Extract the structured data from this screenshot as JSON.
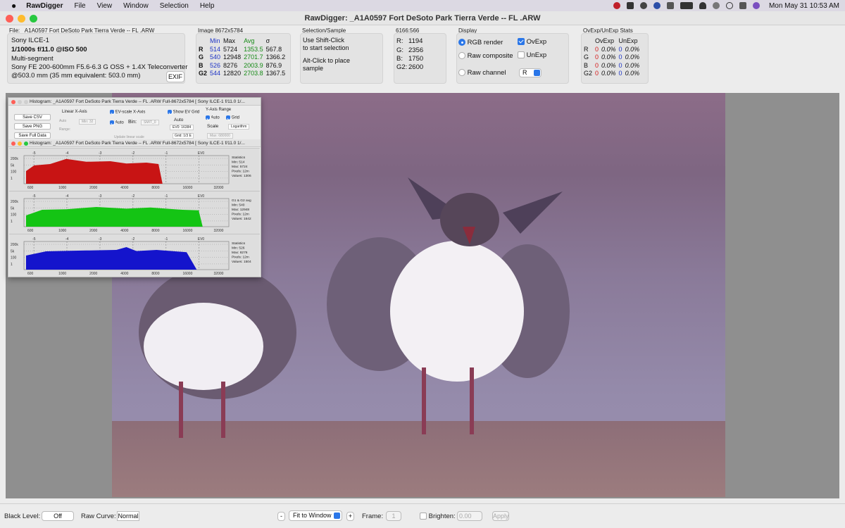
{
  "menubar": {
    "apple": "",
    "app": "RawDigger",
    "items": [
      "File",
      "View",
      "Window",
      "Selection",
      "Help"
    ],
    "clock": "Mon May 31  10:53 AM"
  },
  "window": {
    "title": "RawDigger: _A1A0597 Fort DeSoto Park Tierra Verde -- FL .ARW"
  },
  "file_panel": {
    "label": "File: _A1A0597 Fort DeSoto Park Tierra Verde -- FL .ARW",
    "camera": "Sony ILCE-1",
    "exposure": "1/1000s f/11.0 @ISO 500",
    "metering": "Multi-segment",
    "lens": "Sony FE 200-600mm F5.6-6.3 G OSS + 1.4X Teleconverter",
    "focal": "@503.0 mm (35 mm equivalent: 503.0 mm)",
    "exif_button": "EXIF"
  },
  "image_panel": {
    "label": "Image 8672x5784",
    "headers": [
      "Min",
      "Max",
      "Avg",
      "σ"
    ],
    "rows": [
      {
        "ch": "R",
        "min": "514",
        "max": "5724",
        "avg": "1353.5",
        "sd": "567.8"
      },
      {
        "ch": "G",
        "min": "540",
        "max": "12948",
        "avg": "2701.7",
        "sd": "1366.2"
      },
      {
        "ch": "B",
        "min": "526",
        "max": "8276",
        "avg": "2003.9",
        "sd": "876.9"
      },
      {
        "ch": "G2",
        "min": "544",
        "max": "12820",
        "avg": "2703.8",
        "sd": "1367.5"
      }
    ]
  },
  "selection_panel": {
    "label": "Selection/Sample",
    "line1": "Use Shift-Click",
    "line2": "to start selection",
    "line3": "Alt-Click to place",
    "line4": "sample"
  },
  "pixel_panel": {
    "label": "6166:566",
    "rows": [
      {
        "ch": "R:",
        "v": "1194"
      },
      {
        "ch": "G:",
        "v": "2356"
      },
      {
        "ch": "B:",
        "v": "1750"
      },
      {
        "ch": "G2:",
        "v": "2600"
      }
    ]
  },
  "display_panel": {
    "label": "Display",
    "rgb_render": "RGB render",
    "raw_composite": "Raw composite",
    "raw_channel": "Raw channel",
    "ovexp": "OvExp",
    "unexp": "UnExp",
    "channel_value": "R"
  },
  "stats_panel": {
    "label": "OvExp/UnExp Stats",
    "headers": [
      "OvExp",
      "UnExp"
    ],
    "rows": [
      {
        "ch": "R",
        "ov_n": "0",
        "ov_p": "0.0%",
        "un_n": "0",
        "un_p": "0.0%"
      },
      {
        "ch": "G",
        "ov_n": "0",
        "ov_p": "0.0%",
        "un_n": "0",
        "un_p": "0.0%"
      },
      {
        "ch": "B",
        "ov_n": "0",
        "ov_p": "0.0%",
        "un_n": "0",
        "un_p": "0.0%"
      },
      {
        "ch": "G2",
        "ov_n": "0",
        "ov_p": "0.0%",
        "un_n": "0",
        "un_p": "0.0%"
      }
    ]
  },
  "histogram": {
    "title1": "Histogram: _A1A0597 Fort DeSoto Park Tierra Verde -- FL .ARW Full-8672x5784 [ Sony ILCE-1 f/11.0 1/...",
    "title2": "Histogram: _A1A0597 Fort DeSoto Park Tierra Verde -- FL .ARW Full-8672x5784 [ Sony ILCE-1 f/11.0 1/...",
    "save_csv": "Save CSV",
    "save_png": "Save PNG",
    "save_full": "Save Full Data",
    "linear_x": "Linear X-Axis",
    "auto": "Auto",
    "min_ph": "Min: 32",
    "range": "Range:",
    "ev_scale": "EV-scale X-Axis",
    "bin": "Bin:",
    "bin_ph": "SMIT_0",
    "update_linear": "Update linear scale",
    "show_ev_grid": "Show EV Grid",
    "ev0": "EV0: 16384",
    "grid": "Grid: 1/3 E",
    "yaxis": "Y-Axis Range",
    "y_auto": "Auto",
    "y_grid": "Grid",
    "scale": "Scale",
    "scale_val": "Logarithm",
    "max_ph": "Max: 680000",
    "ev_ticks": [
      "-5",
      "-4",
      "-3",
      "-2",
      "-1",
      "EV0"
    ],
    "x_ticks": [
      "600",
      "1000",
      "2000",
      "4000",
      "8000",
      "16000",
      "32000"
    ],
    "y_ticks": [
      "200k",
      "5k",
      "100",
      "1"
    ],
    "panels": [
      {
        "color": "#c81414",
        "stats": [
          "Statistics",
          "Min: 514",
          "Max: 5724",
          "Pixels: 12m",
          "Values: 1306"
        ]
      },
      {
        "color": "#14c414",
        "stats": [
          "G1 & G2 avg",
          "Min: 540",
          "Max: 12948",
          "Pixels: 12m",
          "Values: 1642"
        ]
      },
      {
        "color": "#1414cc",
        "stats": [
          "Statistics",
          "Min: 526",
          "Max: 8276",
          "Pixels: 12m",
          "Values: 1504"
        ]
      }
    ]
  },
  "bottombar": {
    "black_level_label": "Black Level:",
    "black_level_value": "Off",
    "raw_curve_label": "Raw Curve:",
    "raw_curve_value": "Normal",
    "minus": "-",
    "zoom": "Fit to Window",
    "plus": "+",
    "frame_label": "Frame:",
    "frame_value": "1",
    "brighten": "Brighten:",
    "brighten_value": "0.00",
    "apply": "Apply"
  },
  "colors": {
    "accent": "#2a76e8",
    "photo_tint": "#8a6a86",
    "red": "#d51a1a",
    "blue": "#1f35c6",
    "green": "#158a15"
  }
}
